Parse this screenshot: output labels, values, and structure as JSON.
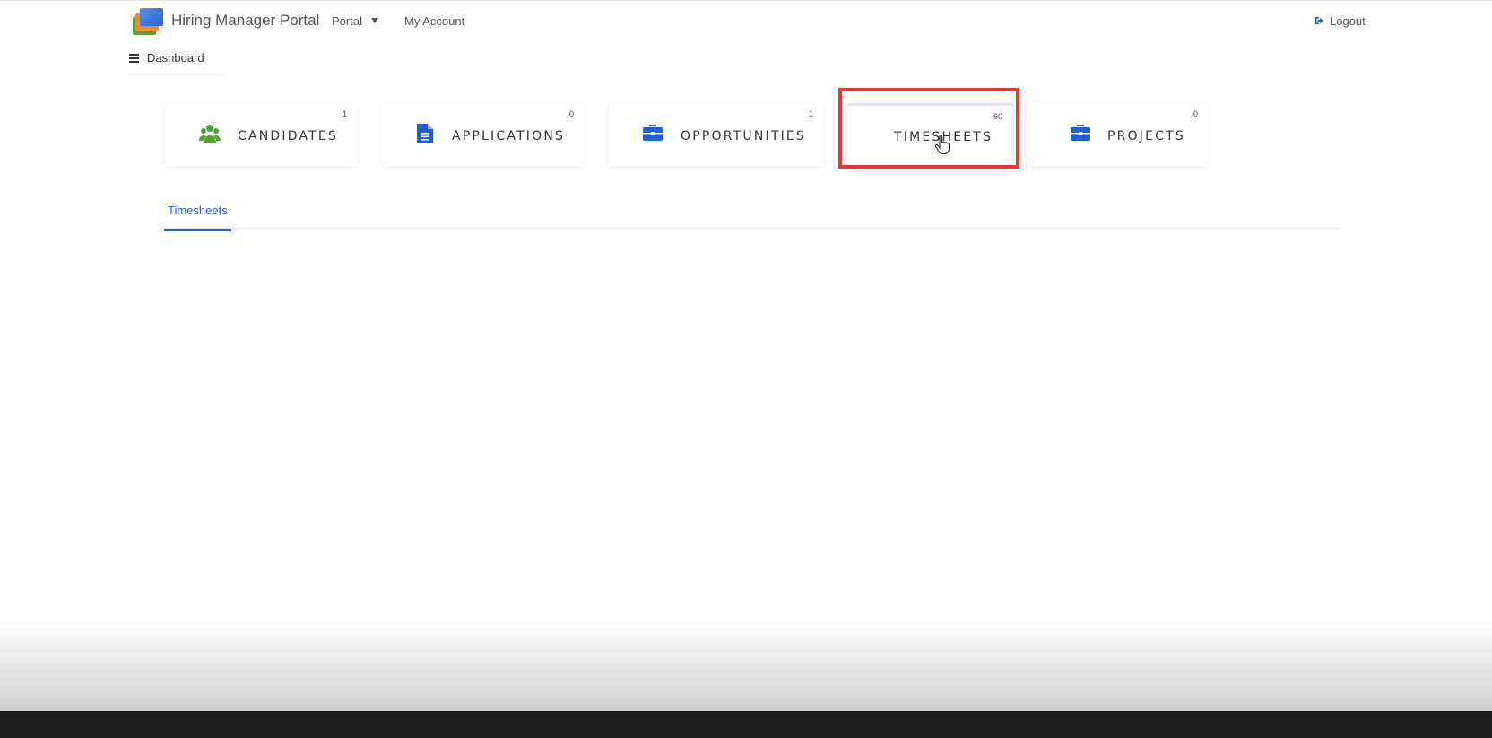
{
  "header": {
    "brand": "Hiring Manager Portal",
    "nav_portal": "Portal",
    "nav_account": "My Account",
    "logout": "Logout"
  },
  "sub_nav": {
    "dashboard": "Dashboard"
  },
  "cards": [
    {
      "label": "CANDIDATES",
      "count": "1",
      "icon": "users-icon",
      "icon_color": "#4ea32a"
    },
    {
      "label": "APPLICATIONS",
      "count": "0",
      "icon": "document-icon",
      "icon_color": "#1f5ed6"
    },
    {
      "label": "OPPORTUNITIES",
      "count": "1",
      "icon": "briefcase-icon",
      "icon_color": "#1f5ed6"
    },
    {
      "label": "TIMESHEETS",
      "count": "60",
      "icon": null,
      "icon_color": null
    },
    {
      "label": "PROJECTS",
      "count": "0",
      "icon": "briefcase-icon",
      "icon_color": "#1f5ed6"
    }
  ],
  "tabs": {
    "active": "Timesheets"
  },
  "colors": {
    "accent": "#1f5ed6",
    "highlight": "#e53935",
    "candidates_icon": "#4ea32a"
  }
}
